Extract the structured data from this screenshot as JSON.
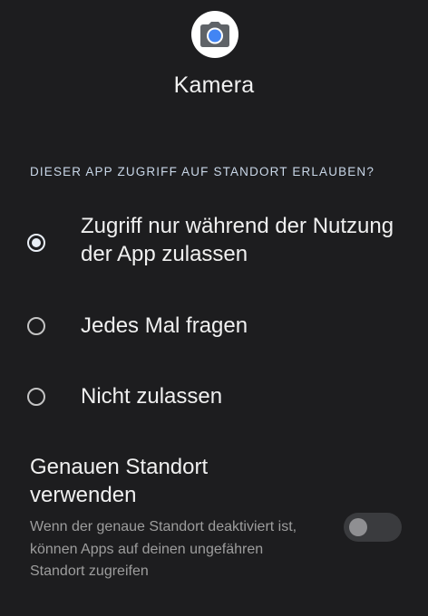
{
  "app": {
    "name": "Kamera",
    "icon": "camera-icon"
  },
  "location_permission": {
    "header": "DIESER APP ZUGRIFF AUF STANDORT ERLAUBEN?",
    "selected_index": 0,
    "options": [
      {
        "label": "Zugriff nur während der Nutzung der App zulassen",
        "selected": true
      },
      {
        "label": "Jedes Mal fragen",
        "selected": false
      },
      {
        "label": "Nicht zulassen",
        "selected": false
      }
    ]
  },
  "precise_location": {
    "title": "Genauen Standort verwenden",
    "description": "Wenn der genaue Standort deaktiviert ist, können Apps auf deinen ungefähren Standort zugreifen",
    "enabled": false
  },
  "colors": {
    "background": "#1d1d1f",
    "camera_lens": "#4285f4",
    "header_text": "#c9d7e8"
  }
}
